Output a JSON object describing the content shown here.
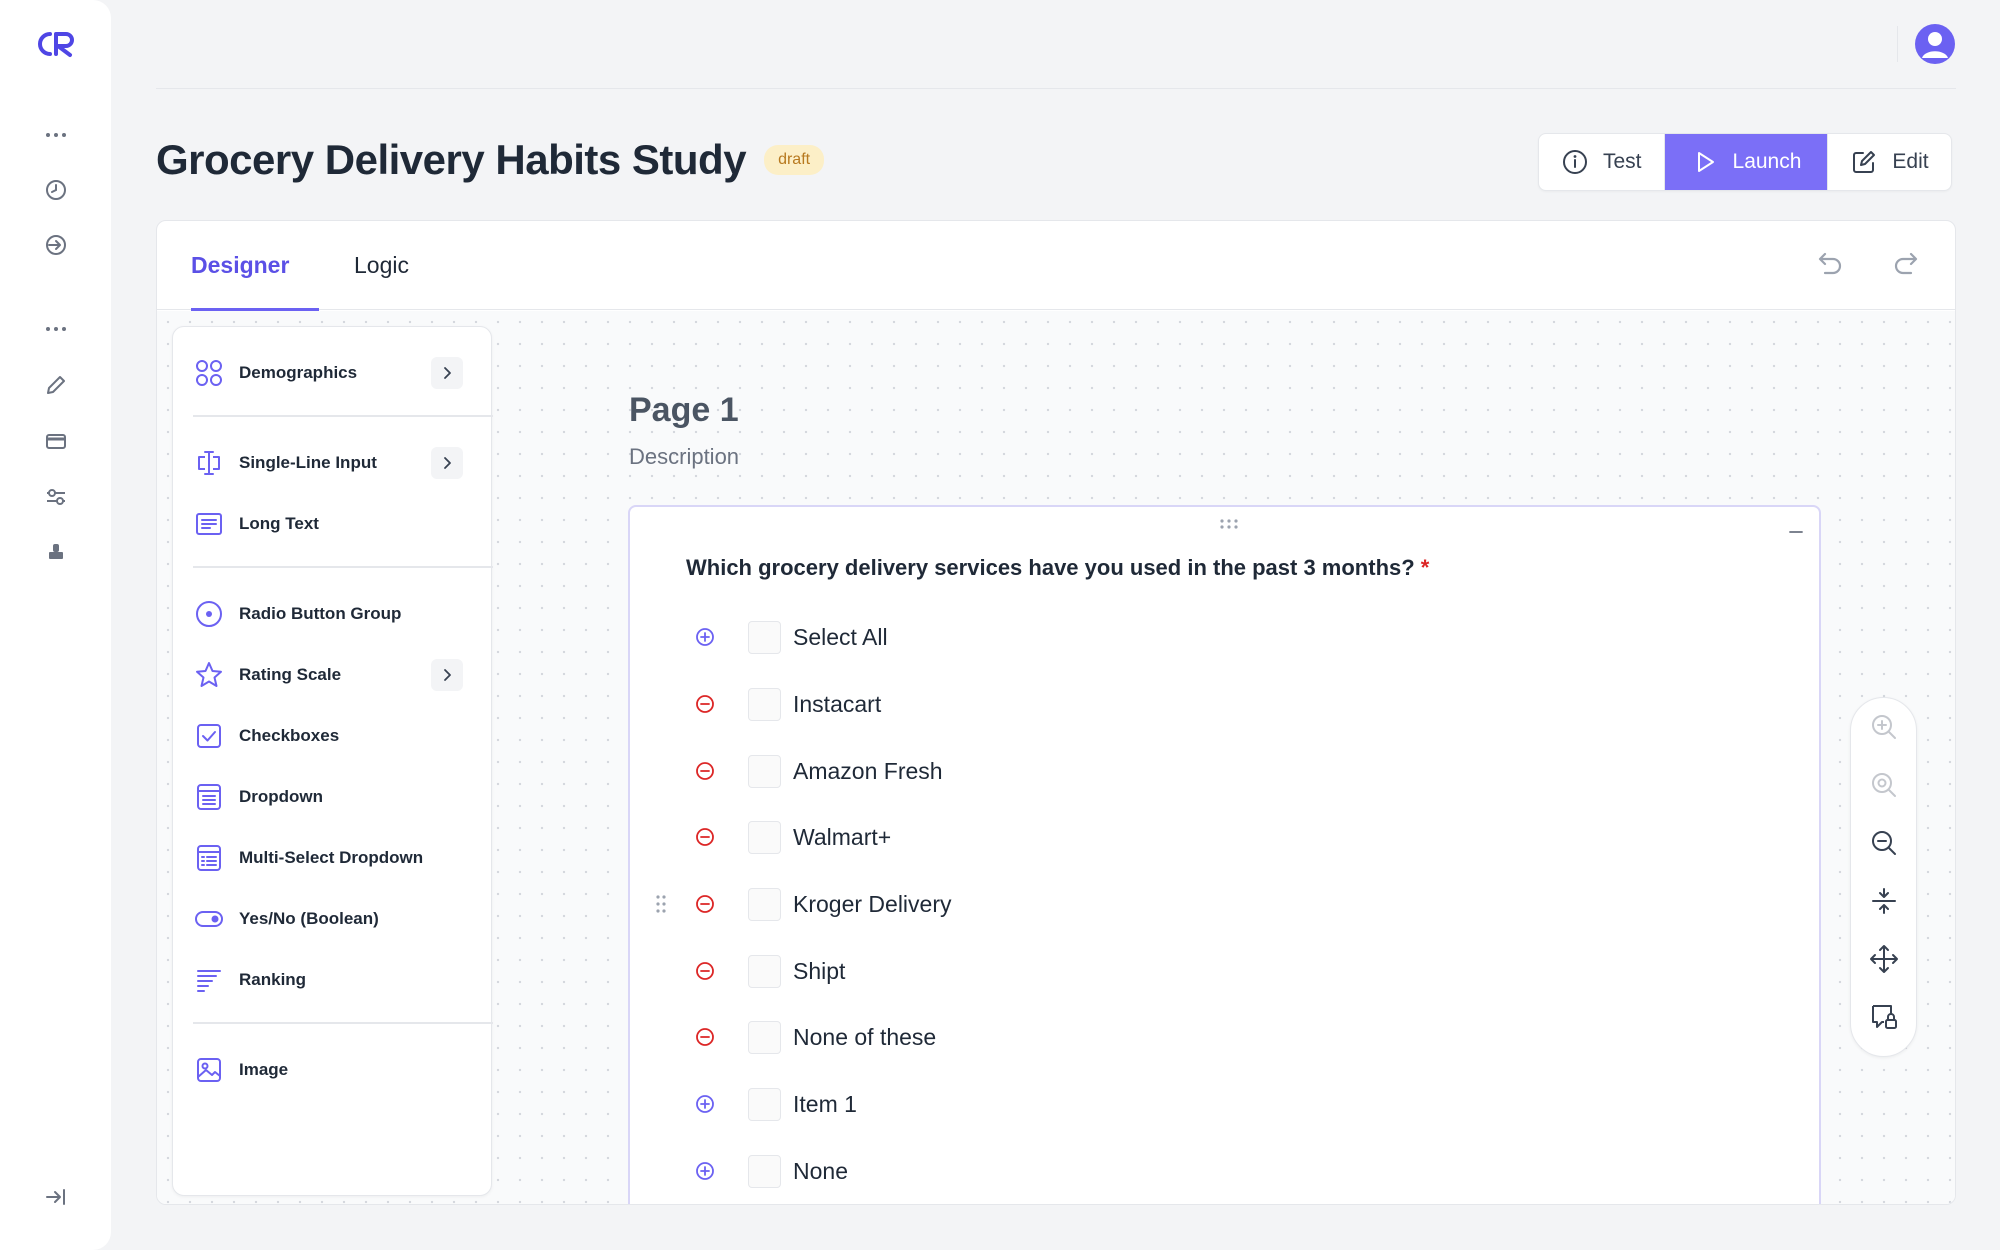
{
  "header": {
    "title": "Grocery Delivery Habits Study",
    "status_badge": "draft",
    "actions": {
      "test": "Test",
      "launch": "Launch",
      "edit": "Edit"
    }
  },
  "tabs": [
    {
      "label": "Designer"
    },
    {
      "label": "Logic"
    }
  ],
  "toolbox": {
    "items": [
      {
        "label": "Demographics",
        "icon": "grid-circles-icon",
        "has_submenu": true
      },
      {
        "label": "Single-Line Input",
        "icon": "text-cursor-icon",
        "has_submenu": true
      },
      {
        "label": "Long Text",
        "icon": "paragraph-icon",
        "has_submenu": false
      },
      {
        "label": "Radio Button Group",
        "icon": "radio-icon",
        "has_submenu": false
      },
      {
        "label": "Rating Scale",
        "icon": "star-icon",
        "has_submenu": true
      },
      {
        "label": "Checkboxes",
        "icon": "checkbox-icon",
        "has_submenu": false
      },
      {
        "label": "Dropdown",
        "icon": "dropdown-list-icon",
        "has_submenu": false
      },
      {
        "label": "Multi-Select Dropdown",
        "icon": "multi-select-icon",
        "has_submenu": false
      },
      {
        "label": "Yes/No (Boolean)",
        "icon": "toggle-icon",
        "has_submenu": false
      },
      {
        "label": "Ranking",
        "icon": "ranking-icon",
        "has_submenu": false
      },
      {
        "label": "Image",
        "icon": "image-icon",
        "has_submenu": false
      }
    ]
  },
  "page": {
    "name": "Page 1",
    "description": "Description",
    "question": {
      "text": "Which grocery delivery services have you used in the past 3 months?",
      "required_mark": "*",
      "options": [
        {
          "label": "Select All",
          "control": "add"
        },
        {
          "label": "Instacart",
          "control": "remove"
        },
        {
          "label": "Amazon Fresh",
          "control": "remove"
        },
        {
          "label": "Walmart+",
          "control": "remove"
        },
        {
          "label": "Kroger Delivery",
          "control": "remove"
        },
        {
          "label": "Shipt",
          "control": "remove"
        },
        {
          "label": "None of these",
          "control": "remove"
        },
        {
          "label": "Item 1",
          "control": "add"
        },
        {
          "label": "None",
          "control": "add"
        }
      ]
    }
  },
  "colors": {
    "accent": "#6b61f2",
    "launch": "#7b6ff7",
    "remove": "#dc2626",
    "badge_bg": "#fcefc7",
    "badge_text": "#b7791f"
  }
}
